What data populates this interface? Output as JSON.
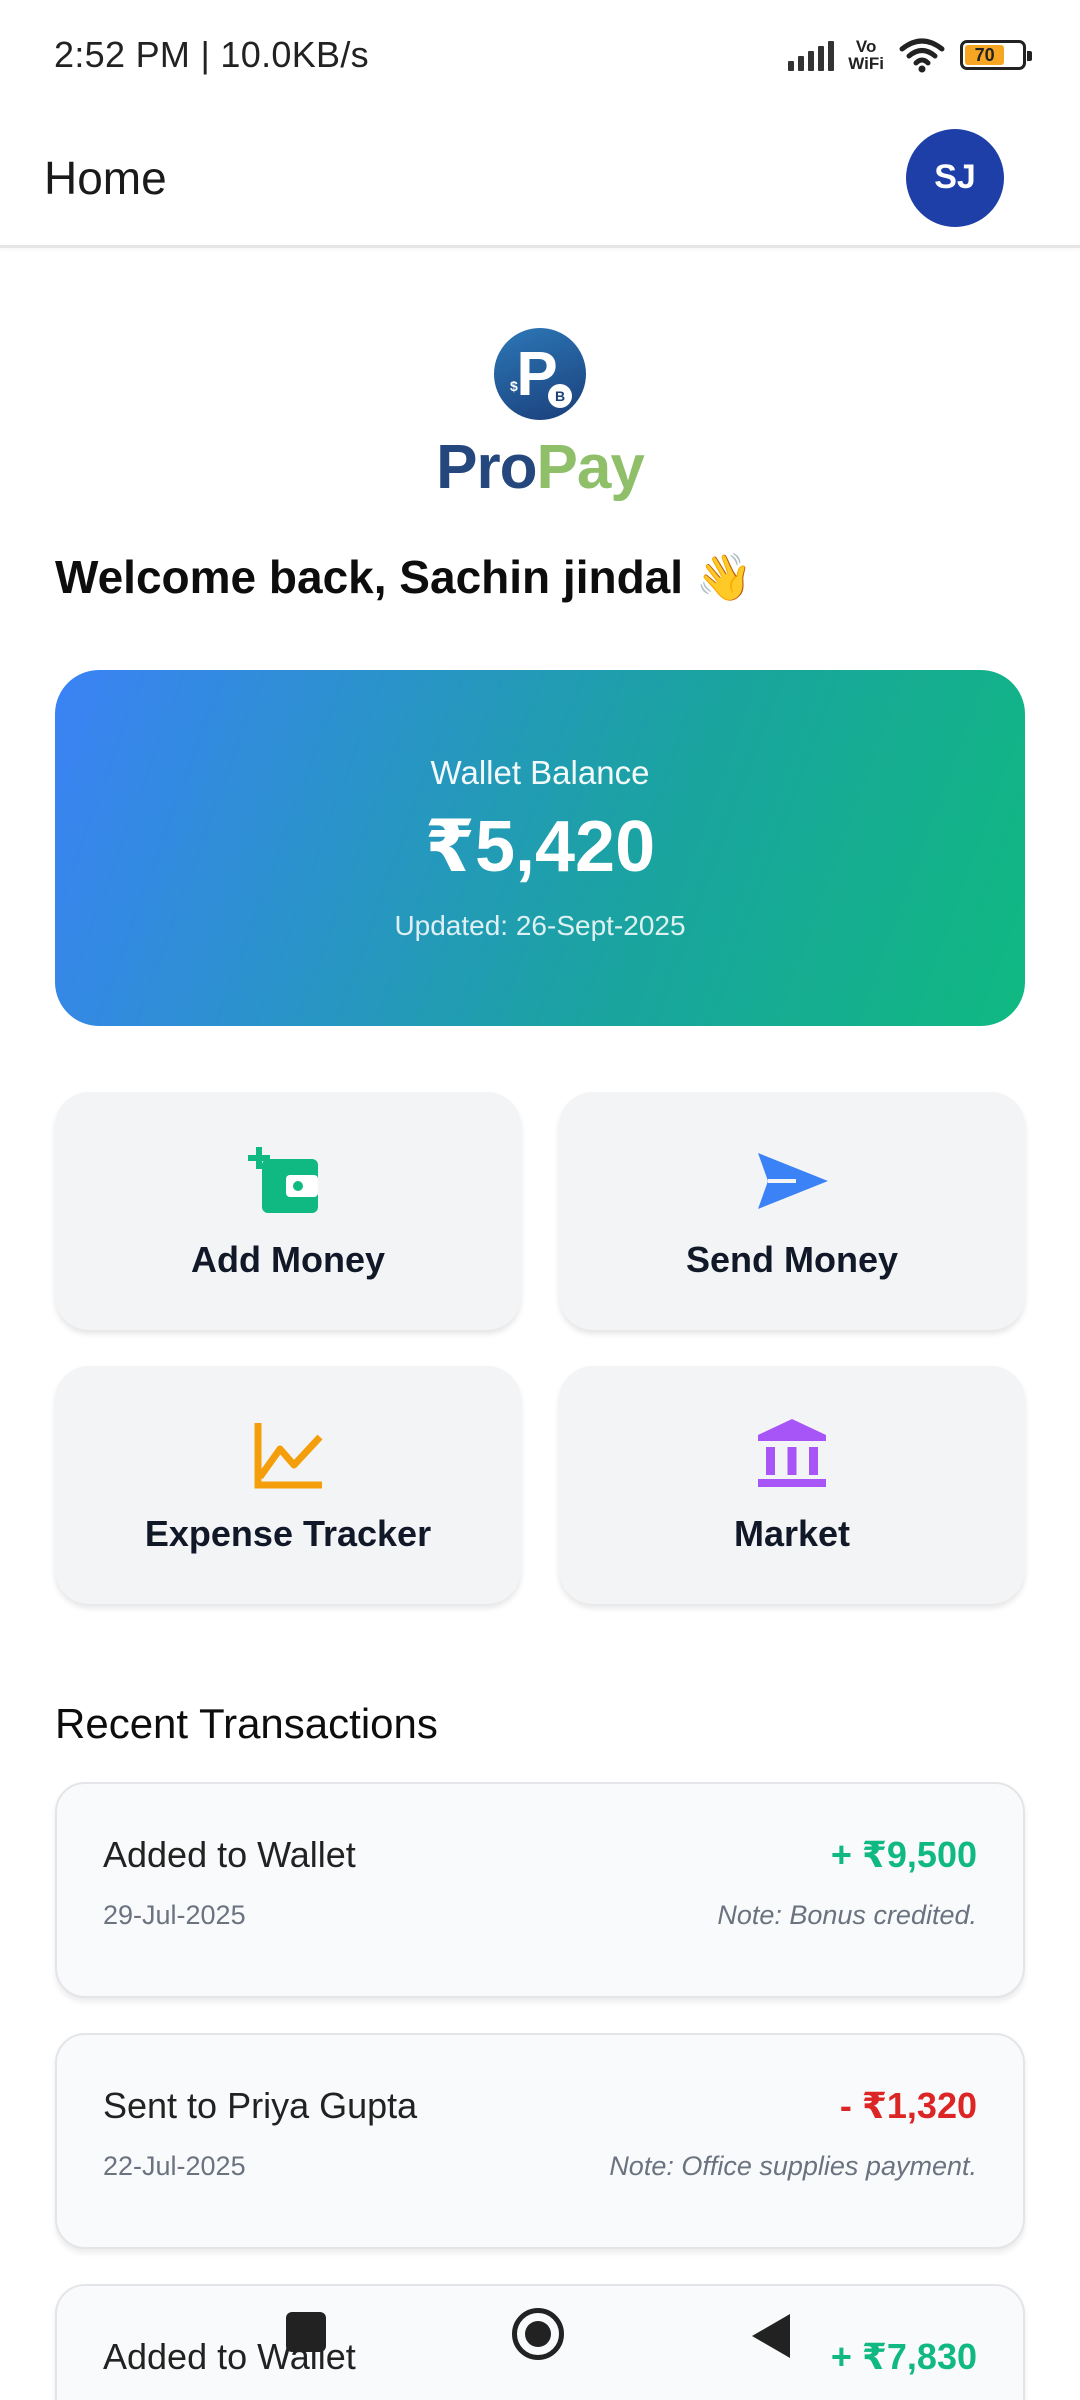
{
  "status_bar": {
    "time": "2:52 PM | 10.0KB/s",
    "network_label_top": "Vo",
    "network_label_bottom": "WiFi",
    "battery": "70",
    "icons": [
      "signal-icon",
      "wifi-icon",
      "battery-icon"
    ]
  },
  "app_bar": {
    "title": "Home",
    "avatar_initials": "SJ",
    "avatar_color": "#1e3fa8"
  },
  "logo": {
    "pro": "Pro",
    "pay": "Pay",
    "mark_letter": "P",
    "coin_symbol": "B",
    "dollar_symbol": "$"
  },
  "welcome": {
    "text": "Welcome back, Sachin jindal 👋"
  },
  "wallet": {
    "label": "Wallet Balance",
    "amount": "₹5,420",
    "updated": "Updated: 26-Sept-2025",
    "gradient_start": "#3b82f6",
    "gradient_end": "#10b981"
  },
  "actions": [
    {
      "label": "Add Money",
      "icon": "add-wallet-icon",
      "color": "#10b981"
    },
    {
      "label": "Send Money",
      "icon": "send-icon",
      "color": "#3b82f6"
    },
    {
      "label": "Expense Tracker",
      "icon": "line-chart-icon",
      "color": "#f59e0b"
    },
    {
      "label": "Market",
      "icon": "bank-icon",
      "color": "#a855f7"
    }
  ],
  "transactions": {
    "title": "Recent Transactions",
    "items": [
      {
        "title": "Added to Wallet",
        "date": "29-Jul-2025",
        "amount": "+ ₹9,500",
        "note": "Note: Bonus credited.",
        "type": "credit"
      },
      {
        "title": "Sent to Priya Gupta",
        "date": "22-Jul-2025",
        "amount": "- ₹1,320",
        "note": "Note: Office supplies payment.",
        "type": "debit"
      },
      {
        "title": "Added to Wallet",
        "date": "",
        "amount": "+ ₹7,830",
        "note": "",
        "type": "credit"
      }
    ]
  },
  "colors": {
    "credit": "#10b981",
    "debit": "#dc2626",
    "card_bg": "#f3f4f6"
  },
  "navigation": {
    "icons": [
      "recents-square-icon",
      "home-circle-icon",
      "back-triangle-icon"
    ]
  }
}
